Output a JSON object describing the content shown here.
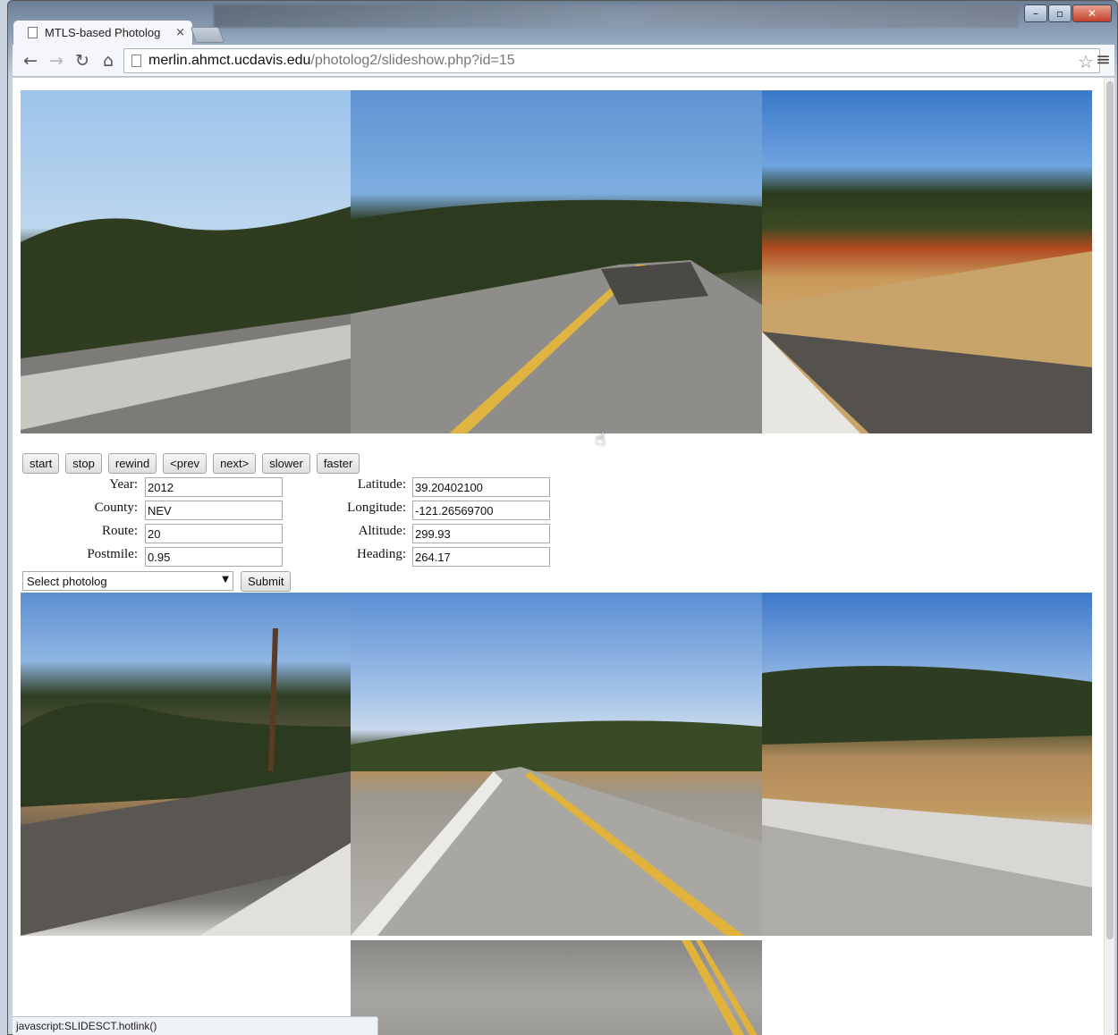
{
  "browser": {
    "tab_title": "MTLS-based Photolog",
    "tab_close": "×",
    "url_host": "merlin.ahmct.ucdavis.edu",
    "url_path": "/photolog2/slideshow.php?id=15",
    "status_text": "javascript:SLIDESCT.hotlink()",
    "icons": [
      "back-icon",
      "forward-icon",
      "reload-icon",
      "home-icon",
      "star-icon",
      "menu-icon",
      "minimize-icon",
      "maximize-icon",
      "close-icon"
    ]
  },
  "controls": {
    "start": "start",
    "stop": "stop",
    "rewind": "rewind",
    "prev": "<prev",
    "next": "next>",
    "slower": "slower",
    "faster": "faster"
  },
  "fields": {
    "year_label": "Year:",
    "year_value": "2012",
    "county_label": "County:",
    "county_value": "NEV",
    "route_label": "Route:",
    "route_value": "20",
    "postmile_label": "Postmile:",
    "postmile_value": "0.95",
    "latitude_label": "Latitude:",
    "latitude_value": "39.20402100",
    "longitude_label": "Longitude:",
    "longitude_value": "-121.26569700",
    "altitude_label": "Altitude:",
    "altitude_value": "299.93",
    "heading_label": "Heading:",
    "heading_value": "264.17"
  },
  "photolog_select": {
    "selected": "Select photolog",
    "submit": "Submit"
  },
  "colors": {
    "sky": "#6fa4e0",
    "road": "#9b9995",
    "lane_line": "#e2b43a"
  }
}
